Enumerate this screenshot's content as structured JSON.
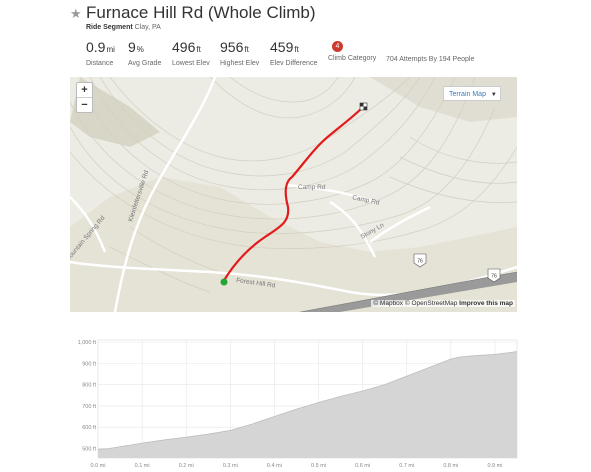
{
  "segment": {
    "title": "Furnace Hill Rd (Whole Climb)",
    "type_label": "Ride Segment",
    "location": "Clay, PA"
  },
  "stats": [
    {
      "value": "0.9",
      "unit": "mi",
      "label": "Distance"
    },
    {
      "value": "9",
      "unit": "%",
      "label": "Avg Grade"
    },
    {
      "value": "496",
      "unit": "ft",
      "label": "Lowest Elev"
    },
    {
      "value": "956",
      "unit": "ft",
      "label": "Highest Elev"
    },
    {
      "value": "459",
      "unit": "ft",
      "label": "Elev Difference"
    }
  ],
  "climb_category": {
    "value": "4",
    "label": "Climb Category"
  },
  "attempts": "704 Attempts By 194 People",
  "map": {
    "zoom_in": "+",
    "zoom_out": "−",
    "terrain_button": "Terrain Map",
    "attribution": {
      "mapbox": "© Mapbox",
      "osm": "© OpenStreetMap",
      "improve": "Improve this map"
    },
    "labels": {
      "camp_rd_1": "Camp Rd",
      "camp_rd_2": "Camp Rd",
      "stony_ln": "Stony Ln",
      "forest_hill_rd": "Forest Hill Rd",
      "kleinfeltersville_rd": "Kleinfeltersville Rd",
      "mountain_spring_rd": "Mountain Spring Rd",
      "route_76a": "76",
      "route_76b": "76"
    }
  },
  "chart_data": {
    "type": "area",
    "xlabel": "",
    "ylabel": "",
    "x_ticks": [
      "0.0 mi",
      "0.1 mi",
      "0.2 mi",
      "0.3 mi",
      "0.4 mi",
      "0.5 mi",
      "0.6 mi",
      "0.7 mi",
      "0.8 mi",
      "0.9 mi"
    ],
    "y_ticks": [
      "500 ft",
      "600 ft",
      "700 ft",
      "800 ft",
      "900 ft",
      "1,000 ft"
    ],
    "xlim": [
      0,
      0.95
    ],
    "ylim": [
      455,
      1010
    ],
    "x": [
      0,
      0.02,
      0.05,
      0.1,
      0.15,
      0.2,
      0.25,
      0.3,
      0.35,
      0.4,
      0.45,
      0.5,
      0.55,
      0.6,
      0.65,
      0.7,
      0.75,
      0.8,
      0.82,
      0.85,
      0.9,
      0.93,
      0.95
    ],
    "values": [
      496,
      498,
      508,
      525,
      540,
      553,
      567,
      585,
      615,
      650,
      685,
      716,
      745,
      770,
      800,
      840,
      880,
      920,
      930,
      936,
      942,
      950,
      956
    ],
    "color": "#d5d5d5",
    "grid": true
  }
}
